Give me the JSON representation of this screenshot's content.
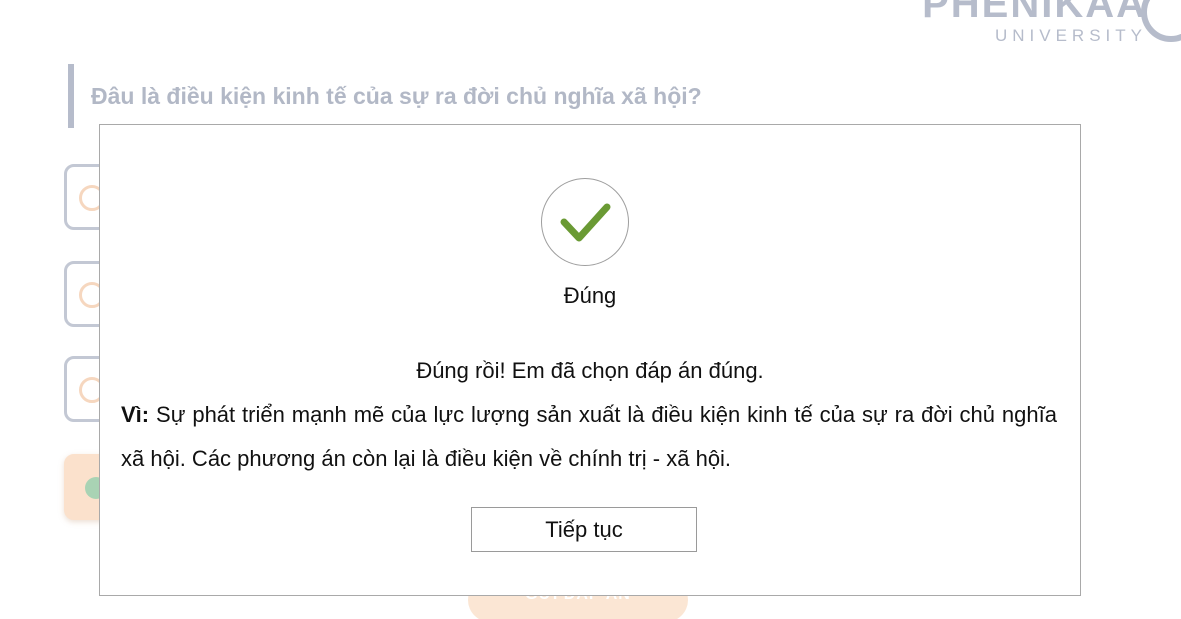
{
  "logo": {
    "name": "PHENIKAA",
    "subtitle": "UNIVERSITY"
  },
  "question": {
    "text": "Đâu là điều kiện kinh tế của sự ra đời chủ nghĩa xã hội?"
  },
  "options": {
    "count_visible": 4,
    "selected_index": 3
  },
  "submit_button": {
    "label": "GỬI ĐÁP ÁN"
  },
  "modal": {
    "icon": "check-icon",
    "title": "Đúng",
    "message": "Đúng rồi! Em đã chọn đáp án đúng.",
    "explanation_lead": "Vì:",
    "explanation": " Sự phát triển mạnh mẽ của lực lượng sản xuất là điều kiện kinh tế của sự ra đời chủ nghĩa xã hội. Các phương án còn lại là điều kiện về chính trị - xã hội.",
    "continue_label": "Tiếp tục"
  },
  "colors": {
    "check": "#6a9a34",
    "background_text": "#b2b8c6",
    "selected_option": "#fbe1cc"
  }
}
